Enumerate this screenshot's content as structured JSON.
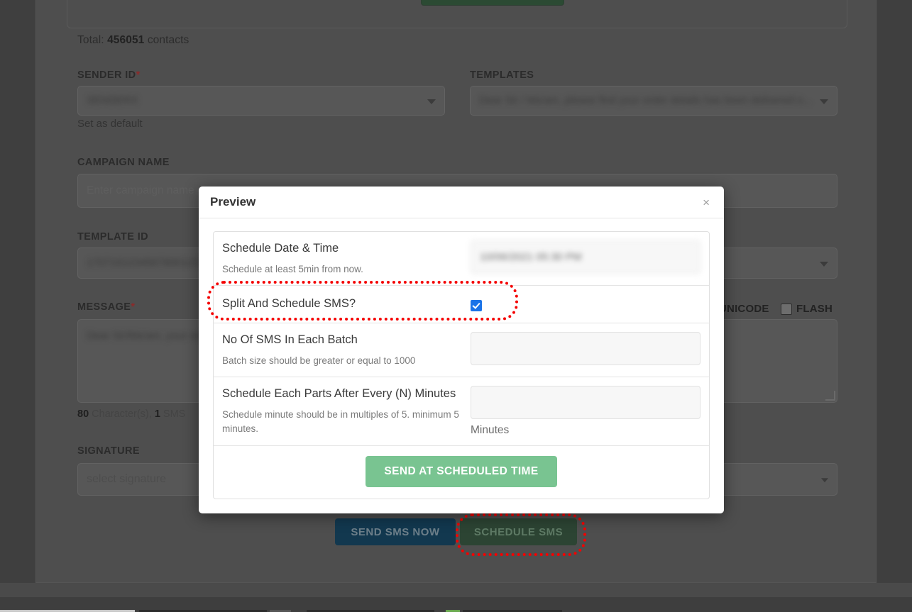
{
  "page": {
    "total_contacts_prefix": "Total:",
    "total_contacts_value": "456051",
    "total_contacts_suffix": "contacts",
    "sender_id_label": "SENDER ID",
    "sender_id_value": "SENDERX",
    "set_as_default": "Set as default",
    "templates_label": "TEMPLATES",
    "templates_value": "Dear Sir / Ma'am, please find your order details has been delivered o...",
    "campaign_name_label": "CAMPAIGN NAME",
    "campaign_name_placeholder": "Enter campaign name",
    "template_id_label": "TEMPLATE ID",
    "template_id_value": "1707161234567890123",
    "message_label": "MESSAGE",
    "message_value": "Dear Sir/Ma'am, your order has been dispatched and",
    "char_count_number": "80",
    "char_count_label": "Character(s),",
    "sms_count_number": "1",
    "sms_count_label": "SMS",
    "unicode_label": "UNICODE",
    "flash_label": "FLASH",
    "signature_label": "SIGNATURE",
    "signature_placeholder": "select signature",
    "required_marker": "*"
  },
  "actions": {
    "send_sms_now": "SEND SMS NOW",
    "schedule_sms": "SCHEDULE SMS"
  },
  "modal": {
    "title": "Preview",
    "close_glyph": "×",
    "rows": [
      {
        "title": "Schedule Date & Time",
        "sub": "Schedule at least 5min from now.",
        "value": "10/06/2021 05:30 PM",
        "unit": ""
      },
      {
        "title": "Split And Schedule SMS?",
        "sub": "",
        "value": "",
        "unit": ""
      },
      {
        "title": "No Of SMS In Each Batch",
        "sub": "Batch size should be greater or equal to 1000",
        "value": "",
        "unit": ""
      },
      {
        "title": "Schedule Each Parts After Every (N) Minutes",
        "sub": "Schedule minute should be in multiples of 5. minimum 5 minutes.",
        "value": "",
        "unit": "Minutes"
      }
    ],
    "submit_label": "SEND AT SCHEDULED TIME"
  },
  "colors": {
    "accent_green": "#79c491",
    "send_now_blue": "#12384f",
    "annotation_red": "#f40000",
    "checkbox_blue": "#1a73e8"
  }
}
